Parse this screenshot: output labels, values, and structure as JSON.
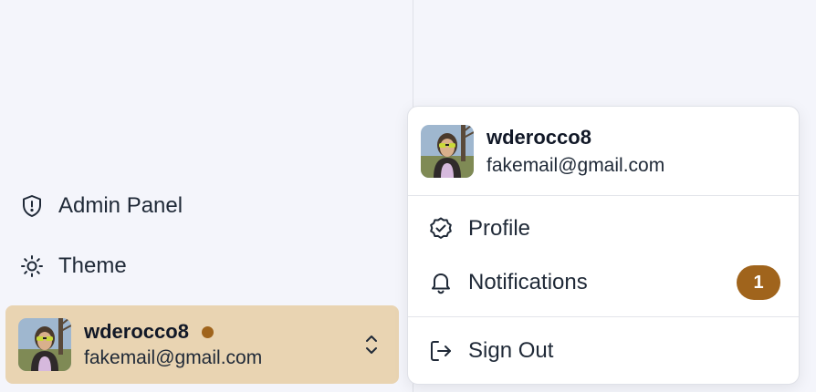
{
  "sidebar": {
    "items": [
      {
        "label": "Admin Panel",
        "icon": "shield-alert-icon"
      },
      {
        "label": "Theme",
        "icon": "sun-icon"
      }
    ]
  },
  "user": {
    "name": "wderocco8",
    "email": "fakemail@gmail.com",
    "status_color": "#a0641c",
    "avatar_icon": "user-avatar-photo"
  },
  "user_menu": {
    "name": "wderocco8",
    "email": "fakemail@gmail.com",
    "items": [
      {
        "label": "Profile",
        "icon": "badge-check-icon"
      },
      {
        "label": "Notifications",
        "icon": "bell-icon",
        "badge": "1"
      },
      {
        "label": "Sign Out",
        "icon": "log-out-icon"
      }
    ]
  },
  "colors": {
    "background": "#f4f5fb",
    "active_card": "#e9d4b2",
    "accent": "#a0641c",
    "text": "#1f2937"
  }
}
